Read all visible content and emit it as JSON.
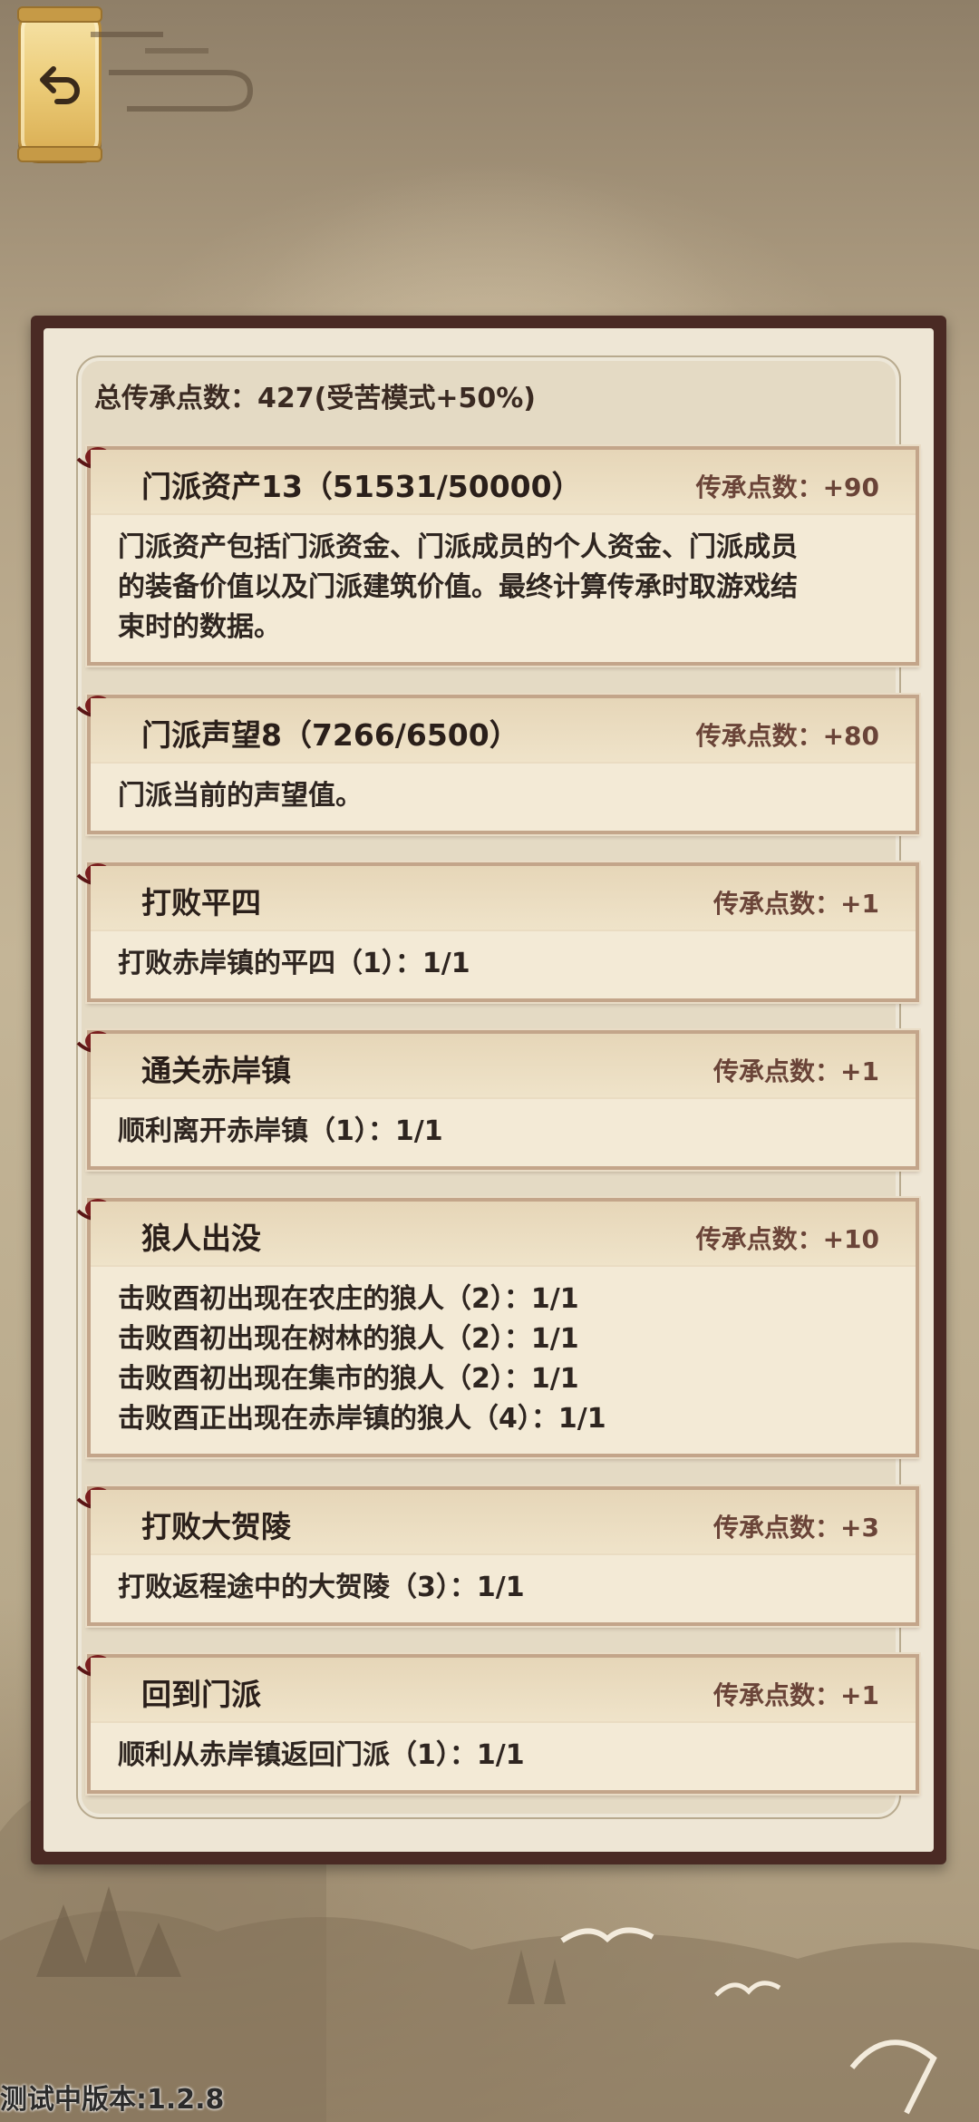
{
  "header": {
    "back_icon": "back-arrow-icon"
  },
  "summary": {
    "total_label": "总传承点数：427(受苦模式+50%)"
  },
  "cards": [
    {
      "title": "门派资产13（51531/50000）",
      "points": "传承点数：+90",
      "lines": [
        "门派资产包括门派资金、门派成员的个人资金、门派成员",
        "的装备价值以及门派建筑价值。最终计算传承时取游戏结",
        "束时的数据。"
      ]
    },
    {
      "title": "门派声望8（7266/6500）",
      "points": "传承点数：+80",
      "lines": [
        "门派当前的声望值。"
      ]
    },
    {
      "title": "打败平四",
      "points": "传承点数：+1",
      "lines": [
        "打败赤岸镇的平四（1）：1/1"
      ]
    },
    {
      "title": "通关赤岸镇",
      "points": "传承点数：+1",
      "lines": [
        "顺利离开赤岸镇（1）：1/1"
      ]
    },
    {
      "title": "狼人出没",
      "points": "传承点数：+10",
      "lines": [
        "击败酉初出现在农庄的狼人（2）：1/1",
        "击败酉初出现在树林的狼人（2）：1/1",
        "击败酉初出现在集市的狼人（2）：1/1",
        "击败酉正出现在赤岸镇的狼人（4）：1/1"
      ]
    },
    {
      "title": "打败大贺陵",
      "points": "传承点数：+3",
      "lines": [
        "打败返程途中的大贺陵（3）：1/1"
      ]
    },
    {
      "title": "回到门派",
      "points": "传承点数：+1",
      "lines": [
        "顺利从赤岸镇返回门派（1）：1/1"
      ]
    }
  ],
  "footer": {
    "version": "测试中版本:1.2.8"
  },
  "colors": {
    "frame": "#4a2a24",
    "card_bg": "#f3ead6",
    "accent": "#6a4438",
    "seal": "#7a1f1f"
  }
}
